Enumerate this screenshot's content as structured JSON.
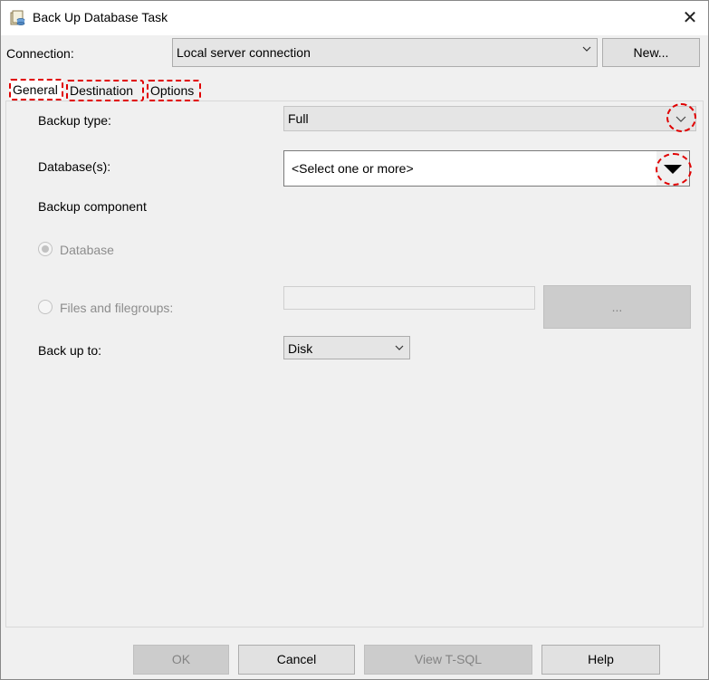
{
  "window": {
    "title": "Back Up Database Task",
    "close_glyph": "✕"
  },
  "connection": {
    "label": "Connection:",
    "value": "Local server connection",
    "new_button": "New..."
  },
  "tabs": [
    {
      "label": "General",
      "selected": true
    },
    {
      "label": "Destination",
      "selected": false
    },
    {
      "label": "Options",
      "selected": false
    }
  ],
  "general": {
    "backup_type_label": "Backup type:",
    "backup_type_value": "Full",
    "databases_label": "Database(s):",
    "databases_value": "<Select one or more>",
    "backup_component_label": "Backup component",
    "radio_database": "Database",
    "radio_files": "Files and filegroups:",
    "browse_button": "...",
    "backup_to_label": "Back up to:",
    "backup_to_value": "Disk"
  },
  "buttons": {
    "ok": "OK",
    "cancel": "Cancel",
    "view_tsql": "View T-SQL",
    "help": "Help"
  },
  "colors": {
    "highlight_annotation": "#e00000",
    "window_bg": "#f0f0f0"
  },
  "icons": {
    "app_icon": "database-backup-icon",
    "chevron": "chevron-down-icon",
    "triangle": "triangle-down-icon"
  }
}
